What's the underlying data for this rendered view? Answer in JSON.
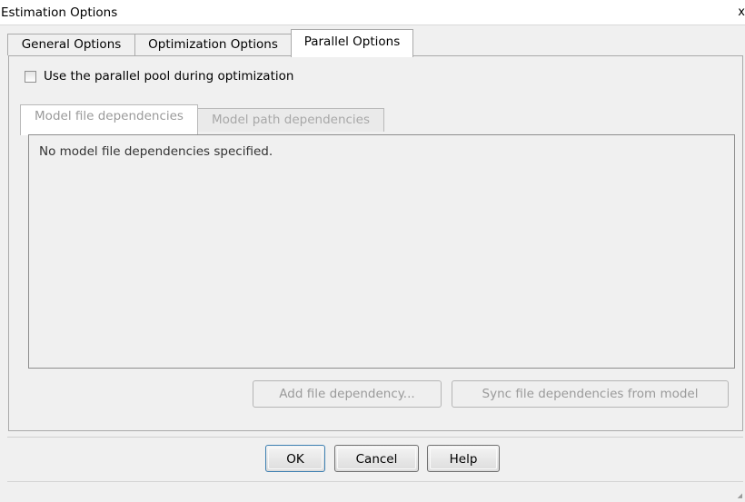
{
  "window": {
    "title": "Estimation Options",
    "close_glyph": "x"
  },
  "tabs": [
    {
      "label": "General Options",
      "active": false
    },
    {
      "label": "Optimization Options",
      "active": false
    },
    {
      "label": "Parallel Options",
      "active": true
    }
  ],
  "parallel": {
    "checkbox_label": "Use the parallel pool during optimization",
    "checkbox_checked": false,
    "subtabs": [
      {
        "label": "Model file dependencies",
        "active": true
      },
      {
        "label": "Model path dependencies",
        "active": false
      }
    ],
    "empty_message": "No model file dependencies specified.",
    "add_button": "Add file dependency...",
    "sync_button": "Sync file dependencies from model"
  },
  "dialog_buttons": {
    "ok": "OK",
    "cancel": "Cancel",
    "help": "Help"
  }
}
